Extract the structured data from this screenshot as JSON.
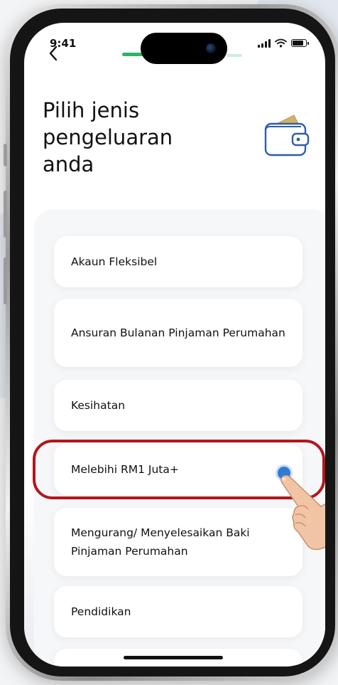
{
  "status_bar": {
    "time": "9:41",
    "icons": [
      "signal-icon",
      "wifi-icon",
      "battery-icon"
    ]
  },
  "header": {
    "back_icon": "chevron-left-icon",
    "title": "Pilih jenis pengeluaran anda",
    "illustration": "wallet-icon"
  },
  "progress": {
    "icon": "progress-indicator",
    "accent_color": "#2fb36a"
  },
  "options": [
    {
      "label": "Akaun Fleksibel"
    },
    {
      "label": "Ansuran Bulanan Pinjaman Perumahan"
    },
    {
      "label": "Kesihatan"
    },
    {
      "label": "Melebihi RM1 Juta+",
      "highlighted": true
    },
    {
      "label": "Mengurang/ Menyelesaikan Baki Pinjaman Perumahan"
    },
    {
      "label": "Pendidikan"
    },
    {
      "label": ""
    }
  ],
  "colors": {
    "highlight": "#b3161c",
    "tap_dot": "#2e7bd6",
    "wallet_stroke": "#2f5fa8",
    "wallet_card": "#d4b26a"
  }
}
